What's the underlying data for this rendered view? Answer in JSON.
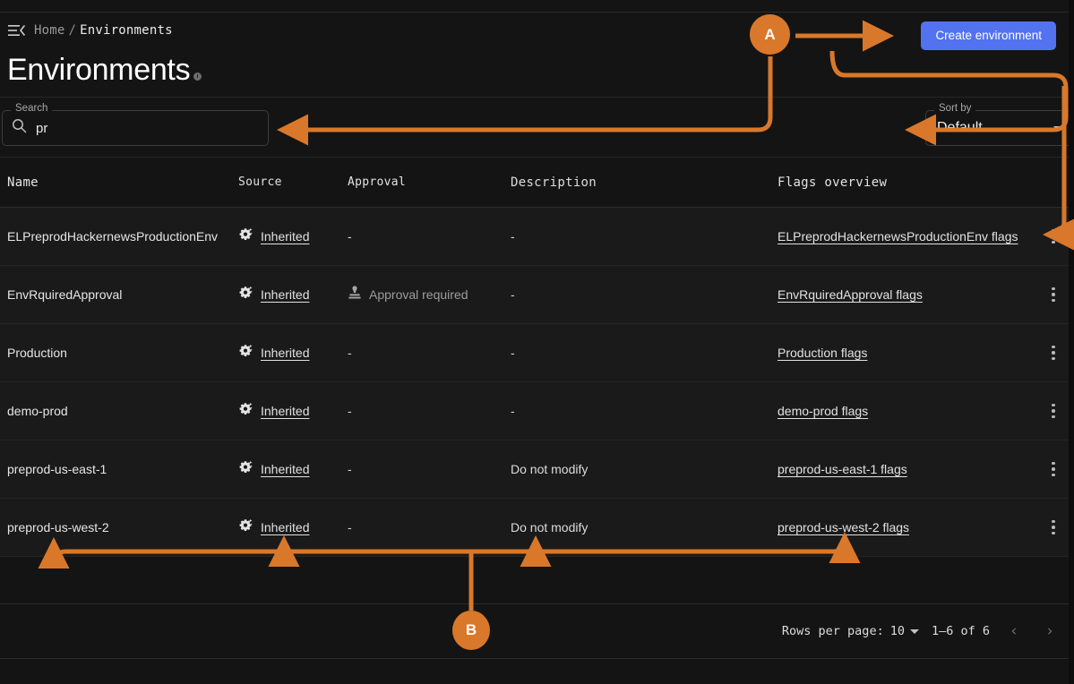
{
  "breadcrumb": {
    "menu_icon": "menu-open-icon",
    "home": "Home",
    "separator": "/",
    "current": "Environments"
  },
  "header": {
    "title": "Environments",
    "info_icon": "info-circle-icon",
    "create_label": "Create environment"
  },
  "filters": {
    "search": {
      "label": "Search",
      "value": "pr",
      "icon": "search-icon",
      "placeholder": ""
    },
    "sort": {
      "label": "Sort by",
      "value": "Default",
      "icon": "chevron-down-icon"
    }
  },
  "table": {
    "columns": [
      "Name",
      "Source",
      "Approval",
      "Description",
      "Flags overview"
    ],
    "rows": [
      {
        "name": "ELPreprodHackernewsProductionEnv",
        "source_icon": "settings-suggest-icon",
        "source": "Inherited",
        "approval": "-",
        "approval_icon": "",
        "description": "-",
        "flags": "ELPreprodHackernewsProductionEnv flags",
        "menu_icon": "more-vertical-icon"
      },
      {
        "name": "EnvRquiredApproval",
        "source_icon": "settings-suggest-icon",
        "source": "Inherited",
        "approval": "Approval required",
        "approval_icon": "approval-stamp-icon",
        "description": "-",
        "flags": "EnvRquiredApproval flags",
        "menu_icon": "more-vertical-icon"
      },
      {
        "name": "Production",
        "source_icon": "settings-suggest-icon",
        "source": "Inherited",
        "approval": "-",
        "approval_icon": "",
        "description": "-",
        "flags": "Production flags",
        "menu_icon": "more-vertical-icon"
      },
      {
        "name": "demo-prod",
        "source_icon": "settings-suggest-icon",
        "source": "Inherited",
        "approval": "-",
        "approval_icon": "",
        "description": "-",
        "flags": "demo-prod flags",
        "menu_icon": "more-vertical-icon"
      },
      {
        "name": "preprod-us-east-1",
        "source_icon": "settings-suggest-icon",
        "source": "Inherited",
        "approval": "-",
        "approval_icon": "",
        "description": "Do not modify",
        "flags": "preprod-us-east-1 flags",
        "menu_icon": "more-vertical-icon"
      },
      {
        "name": "preprod-us-west-2",
        "source_icon": "settings-suggest-icon",
        "source": "Inherited",
        "approval": "-",
        "approval_icon": "",
        "description": "Do not modify",
        "flags": "preprod-us-west-2 flags",
        "menu_icon": "more-vertical-icon"
      }
    ]
  },
  "footer": {
    "rows_per_page_label": "Rows per page:",
    "rows_per_page_value": "10",
    "range": "1–6 of 6",
    "prev_icon": "chevron-left-icon",
    "next_icon": "chevron-right-icon"
  },
  "annotations": {
    "marker_a": "A",
    "marker_b": "B",
    "color": "#d9782a"
  },
  "colors": {
    "accent": "#5272f0",
    "annotation": "#d9782a",
    "background": "#141414",
    "row_background": "#1a1a1a"
  }
}
